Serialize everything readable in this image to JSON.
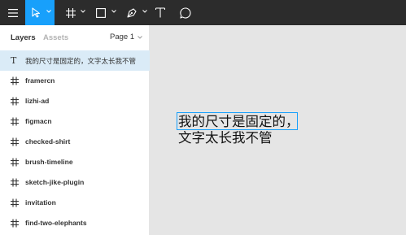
{
  "toolbar": {
    "tools": [
      "menu-icon",
      "move-icon",
      "frame-icon",
      "shape-icon",
      "pen-icon",
      "text-icon",
      "comment-icon"
    ],
    "active_color": "#18a0fb"
  },
  "panel": {
    "tabs": {
      "layers": "Layers",
      "assets": "Assets"
    },
    "page": "Page 1",
    "layers": [
      {
        "label": "我的尺寸是固定的，文字太长我不管",
        "icon": "text-layer-icon"
      },
      {
        "label": "framercn",
        "icon": "frame-icon"
      },
      {
        "label": "lizhi-ad",
        "icon": "frame-icon"
      },
      {
        "label": "figmacn",
        "icon": "frame-icon"
      },
      {
        "label": "checked-shirt",
        "icon": "frame-icon"
      },
      {
        "label": "brush-timeline",
        "icon": "frame-icon"
      },
      {
        "label": "sketch-jike-plugin",
        "icon": "frame-icon"
      },
      {
        "label": "invitation",
        "icon": "frame-icon"
      },
      {
        "label": "find-two-elephants",
        "icon": "frame-icon"
      }
    ]
  },
  "canvas": {
    "text": "我的尺寸是固定的，文字太长我不管"
  }
}
